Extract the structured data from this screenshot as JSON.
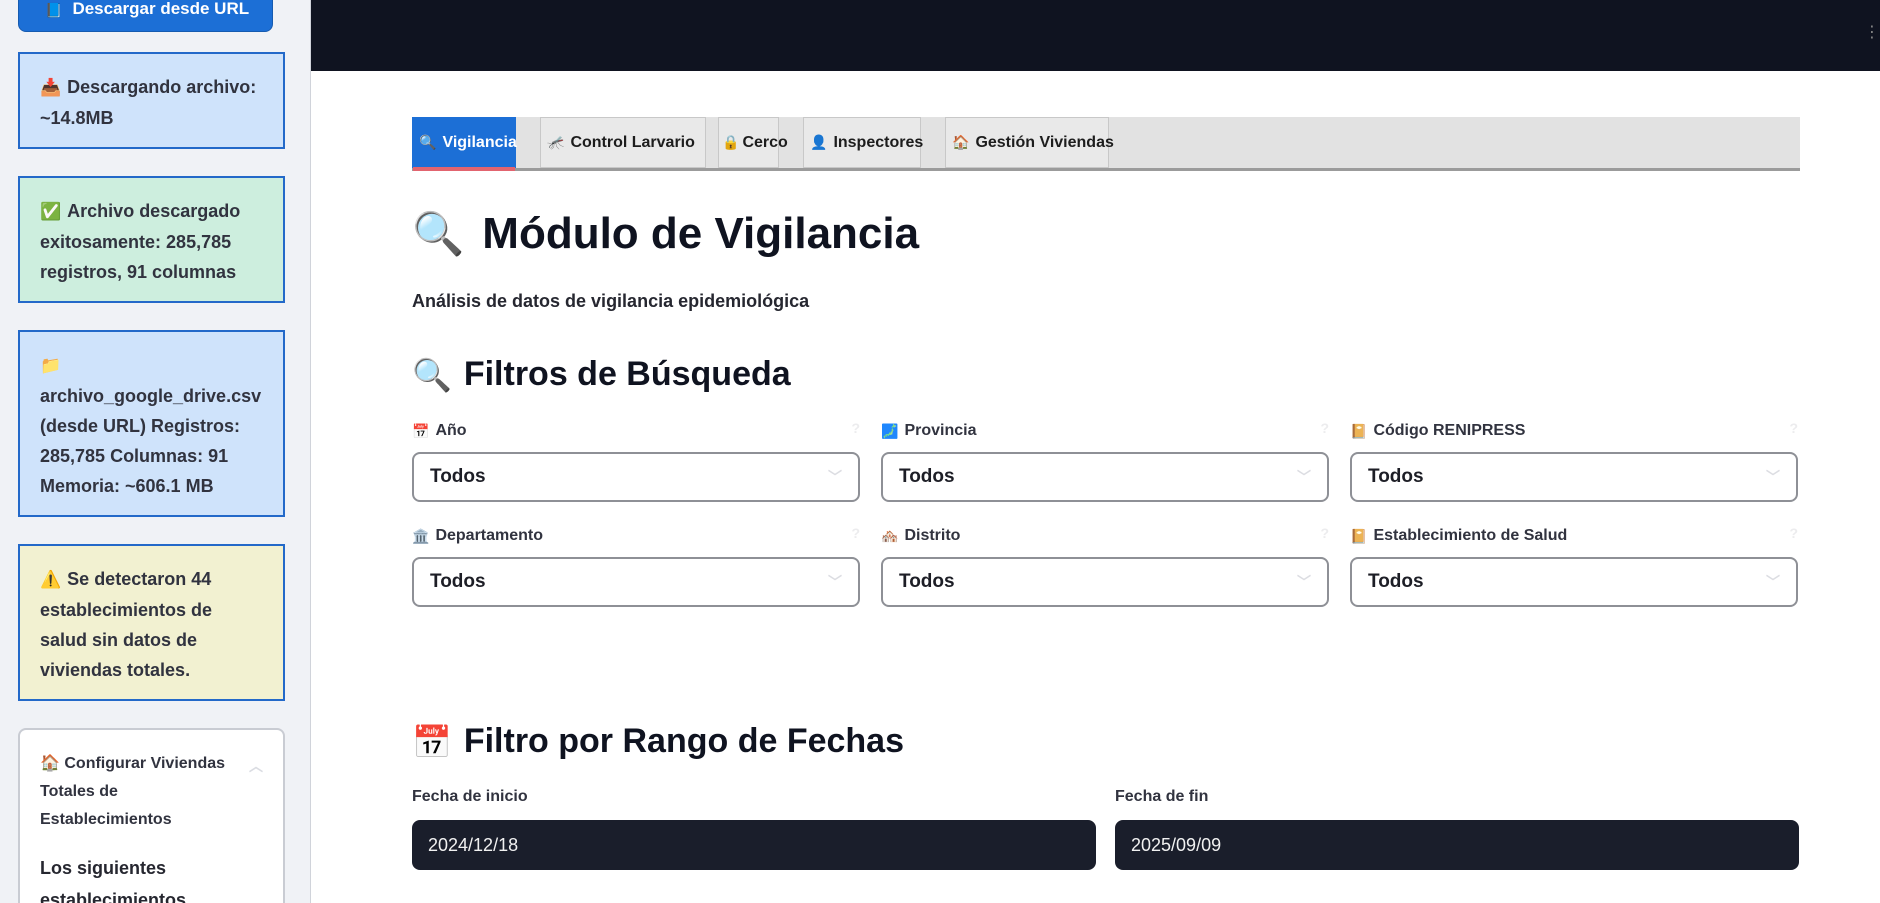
{
  "sidebar": {
    "download_button": {
      "icon": "book-icon",
      "label": "Descargar desde URL"
    },
    "alerts": [
      {
        "type": "info",
        "icon": "inbox-tray-icon",
        "text": "Descargando archivo: ~14.8MB"
      },
      {
        "type": "success",
        "icon": "check-mark-icon",
        "text": "Archivo descargado exitosamente: 285,785 registros, 91 columnas"
      },
      {
        "type": "info",
        "icon": "folder-icon",
        "text": "archivo_google_drive.csv (desde URL) Registros: 285,785 Columnas: 91 Memoria: ~606.1 MB"
      },
      {
        "type": "warning",
        "icon": "warning-icon",
        "text": "Se detectaron 44 establecimientos de salud sin datos de viviendas totales."
      }
    ],
    "expander": {
      "icon": "house-icon",
      "title": "Configurar Viviendas Totales de Establecimientos",
      "body": "Los siguientes establecimientos"
    }
  },
  "tabs": [
    {
      "icon": "magnifier-icon",
      "label": "Vigilancia",
      "active": true
    },
    {
      "icon": "mosquito-icon",
      "label": "Control Larvario",
      "active": false
    },
    {
      "icon": "lock-icon",
      "label": "Cerco",
      "active": false
    },
    {
      "icon": "person-icon",
      "label": "Inspectores",
      "active": false
    },
    {
      "icon": "house-icon",
      "label": "Gestión Viviendas",
      "active": false
    }
  ],
  "page": {
    "title": "Módulo de Vigilancia",
    "subtitle": "Análisis de datos de vigilancia epidemiológica"
  },
  "filters": {
    "heading": "Filtros de Búsqueda",
    "fields": [
      {
        "icon": "calendar-icon",
        "label": "Año",
        "value": "Todos"
      },
      {
        "icon": "map-icon",
        "label": "Provincia",
        "value": "Todos"
      },
      {
        "icon": "notebook-icon",
        "label": "Código RENIPRESS",
        "value": "Todos"
      },
      {
        "icon": "classical-building-icon",
        "label": "Departamento",
        "value": "Todos"
      },
      {
        "icon": "houses-icon",
        "label": "Distrito",
        "value": "Todos"
      },
      {
        "icon": "notebook-icon",
        "label": "Establecimiento de Salud",
        "value": "Todos"
      }
    ]
  },
  "dates": {
    "heading": "Filtro por Rango de Fechas",
    "start": {
      "label": "Fecha de inicio",
      "value": "2024/12/18"
    },
    "end": {
      "label": "Fecha de fin",
      "value": "2025/09/09"
    }
  },
  "colors": {
    "primary": "#1c6fd6",
    "topbar": "#0f1320",
    "sidebar_bg": "#f0f2f6",
    "info_bg": "#cfe3fb",
    "success_bg": "#cdeede",
    "warning_bg": "#f2f1d1",
    "date_bg": "#1a1e2b"
  }
}
